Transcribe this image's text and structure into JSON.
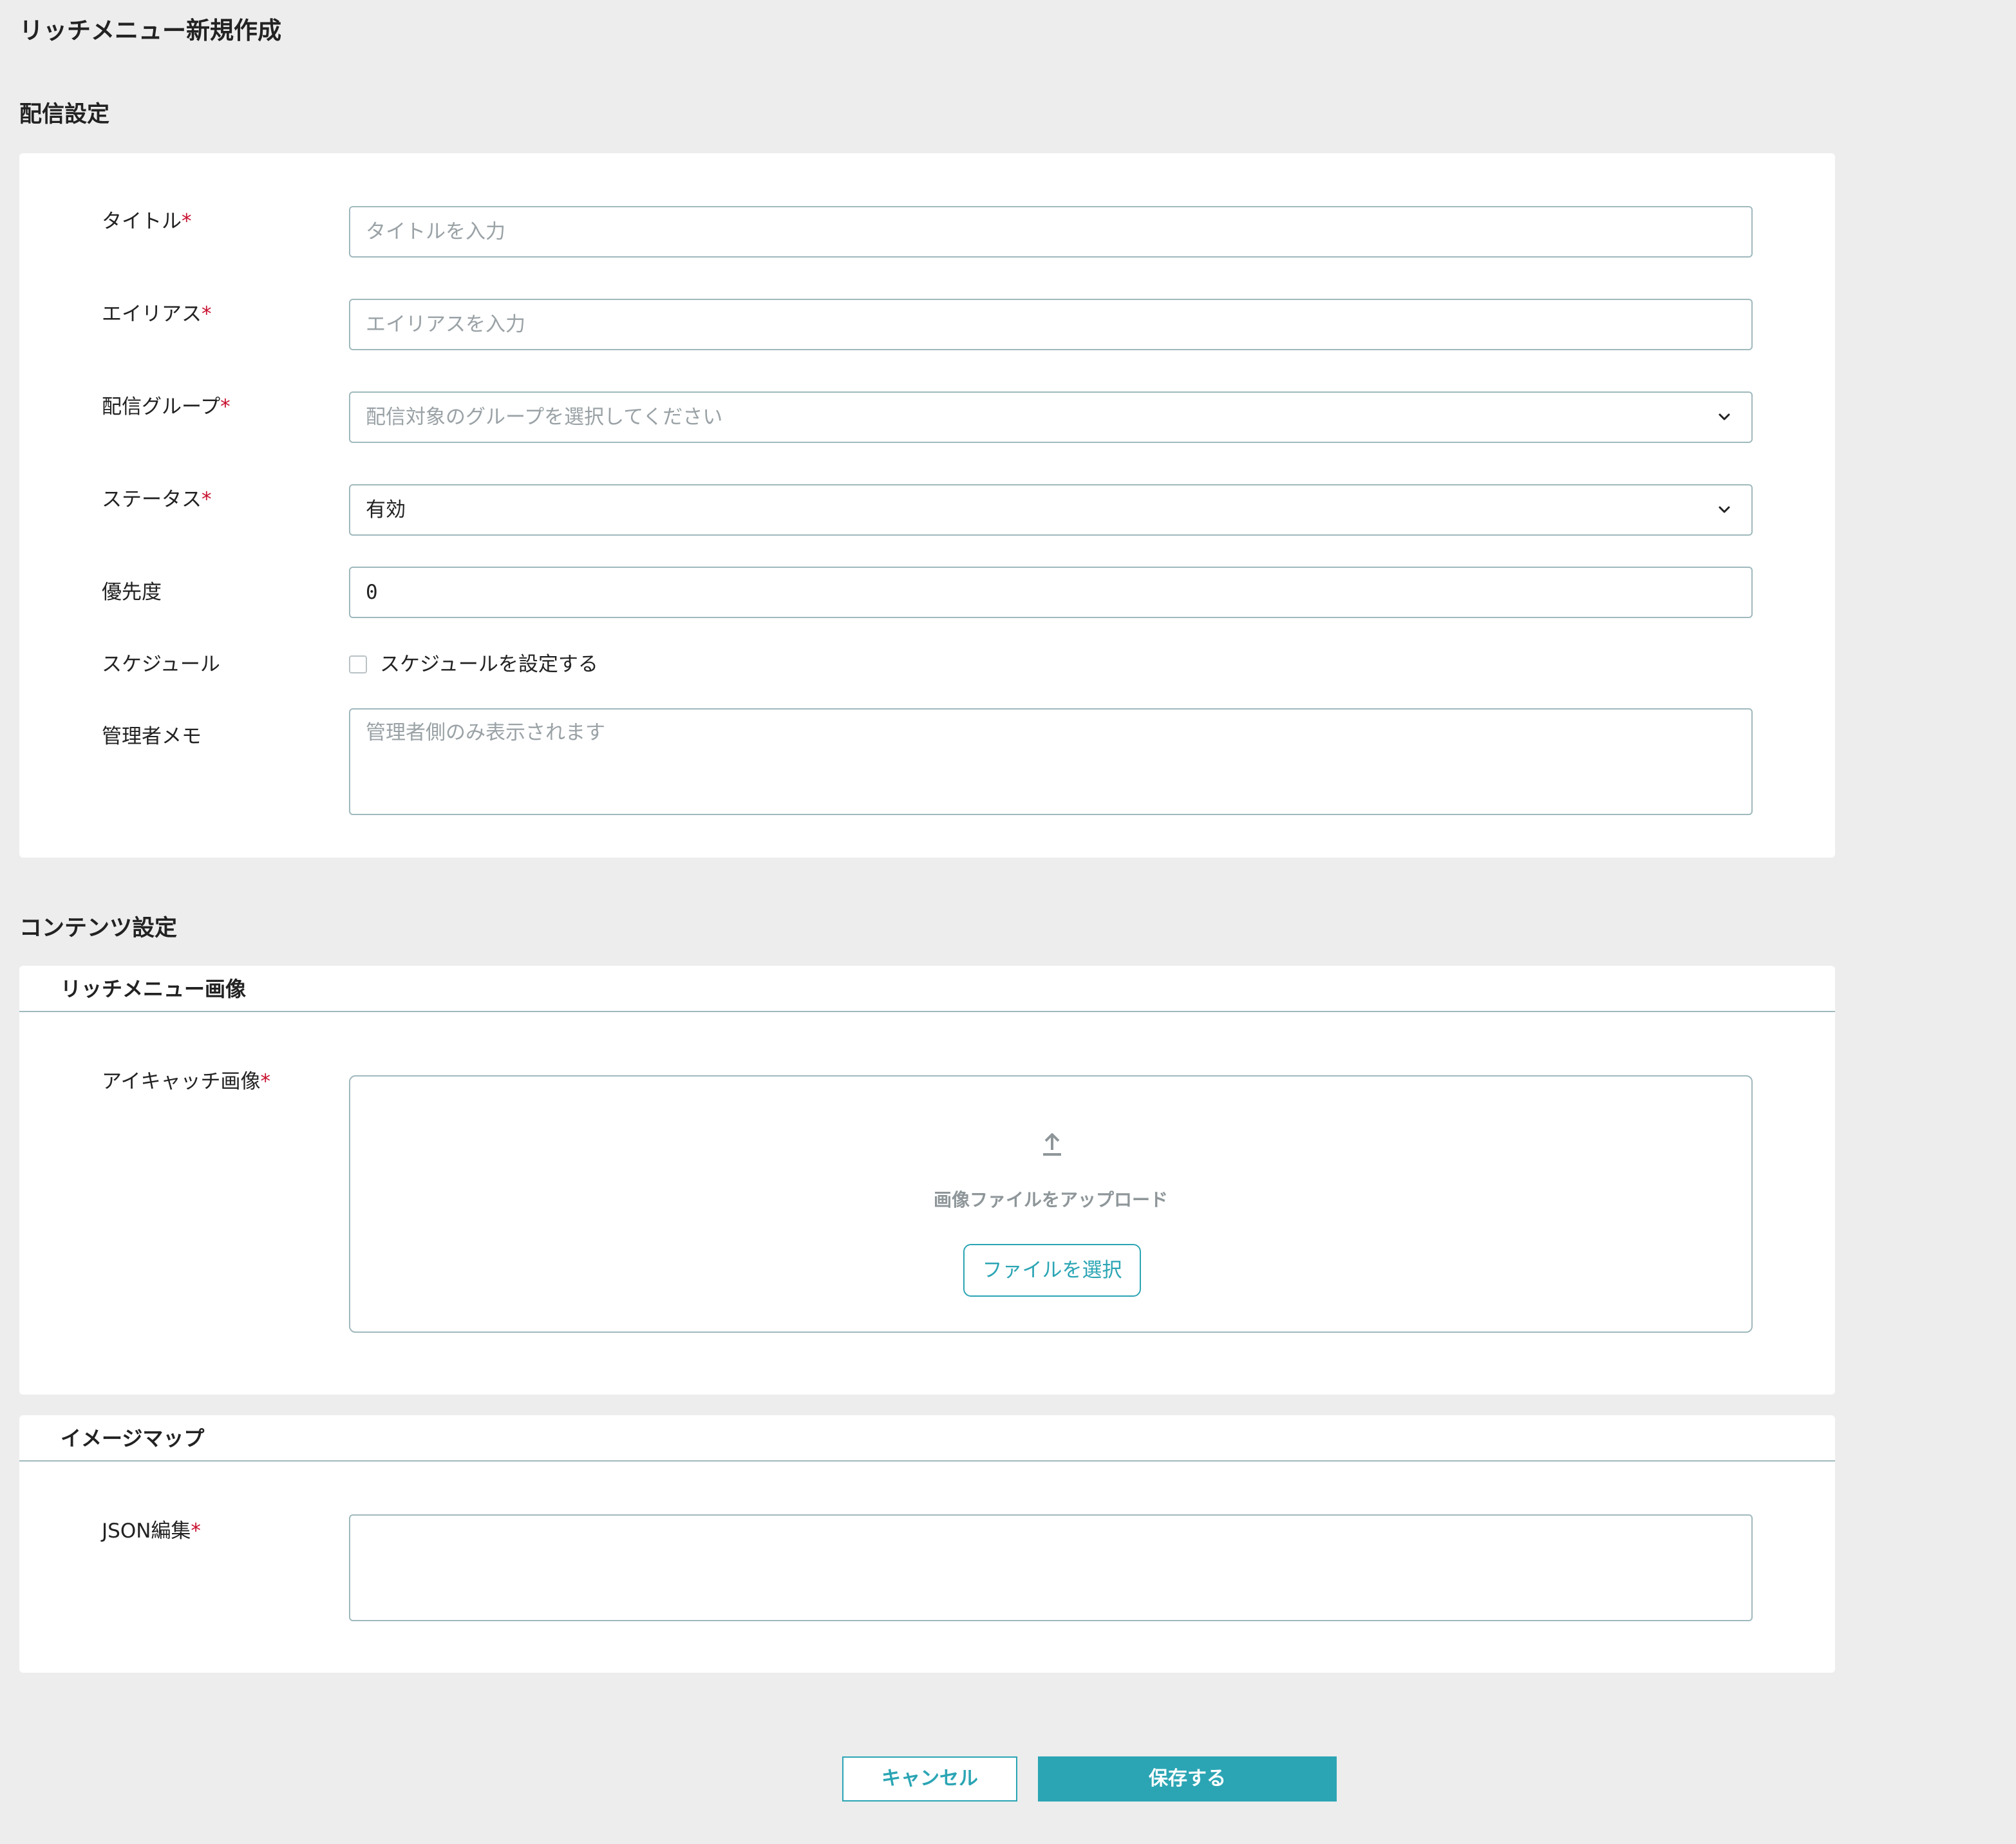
{
  "page": {
    "title": "リッチメニュー新規作成"
  },
  "delivery_settings": {
    "section_title": "配信設定",
    "required_mark": "*",
    "title_field": {
      "label": "タイトル",
      "placeholder": "タイトルを入力"
    },
    "alias_field": {
      "label": "エイリアス",
      "placeholder": "エイリアスを入力"
    },
    "group_field": {
      "label": "配信グループ",
      "placeholder": "配信対象のグループを選択してください",
      "icon": "chevron-down-icon"
    },
    "status_field": {
      "label": "ステータス",
      "value": "有効",
      "icon": "chevron-down-icon"
    },
    "priority_field": {
      "label": "優先度",
      "value": "0"
    },
    "schedule_field": {
      "label": "スケジュール",
      "checkbox_label": "スケジュールを設定する",
      "checked": false
    },
    "memo_field": {
      "label": "管理者メモ",
      "placeholder": "管理者側のみ表示されます"
    }
  },
  "content_settings": {
    "section_title": "コンテンツ設定",
    "rich_menu_image": {
      "header": "リッチメニュー画像",
      "eyecatch_field": {
        "label": "アイキャッチ画像",
        "upload_icon": "upload-icon",
        "upload_text": "画像ファイルをアップロード",
        "select_file_button": "ファイルを選択"
      }
    },
    "imagemap": {
      "header": "イメージマップ",
      "json_field": {
        "label": "JSON編集",
        "value": ""
      }
    }
  },
  "actions": {
    "cancel": "キャンセル",
    "save": "保存する"
  },
  "colors": {
    "accent": "#2ba5b4",
    "required": "#c8102e",
    "border": "#9fb9bd",
    "background": "#ededed"
  }
}
